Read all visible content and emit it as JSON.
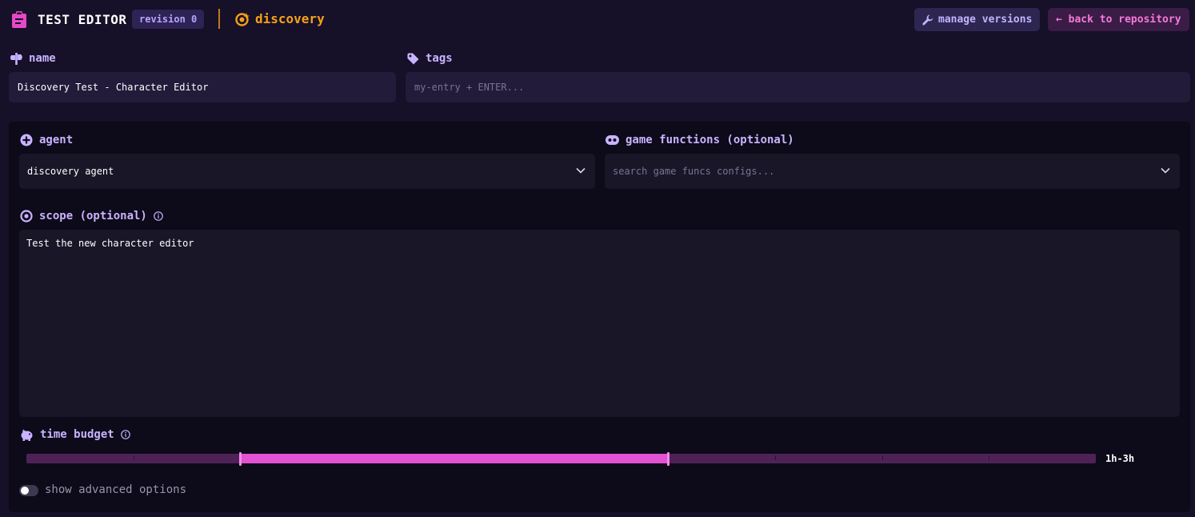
{
  "header": {
    "title": "TEST EDITOR",
    "revision": "revision 0",
    "mode": "discovery",
    "manage_versions": "manage versions",
    "back_to_repository": "← back to repository"
  },
  "name": {
    "label": "name",
    "value": "Discovery Test - Character Editor"
  },
  "tags": {
    "label": "tags",
    "placeholder": "my-entry + ENTER..."
  },
  "agent": {
    "label": "agent",
    "value": "discovery agent"
  },
  "game_functions": {
    "label": "game functions (optional)",
    "placeholder": "search game funcs configs..."
  },
  "scope": {
    "label": "scope (optional)",
    "value": "Test the new character editor"
  },
  "time_budget": {
    "label": "time budget",
    "value_text": "1h-3h",
    "ticks": 10,
    "selected_range": {
      "start_fraction": 0.2,
      "end_fraction": 0.6
    }
  },
  "advanced": {
    "label": "show advanced options",
    "enabled": false
  },
  "colors": {
    "background": "#161028",
    "panel": "#0d0a19",
    "accent_purple": "#c9b3ff",
    "accent_orange": "#f5a01a",
    "accent_pink": "#e252d2"
  }
}
